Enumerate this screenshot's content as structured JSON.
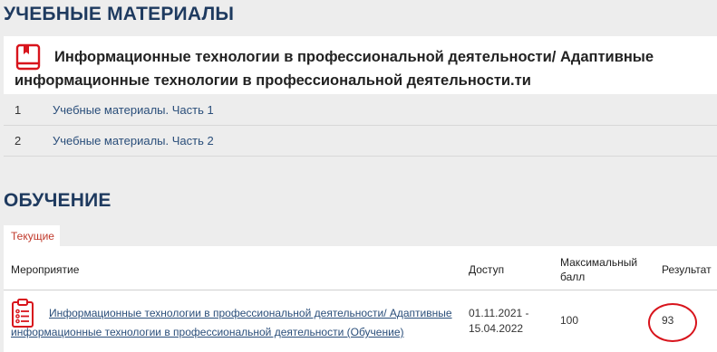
{
  "materials": {
    "title": "УЧЕБНЫЕ МАТЕРИАЛЫ",
    "course_title": "Информационные технологии в профессиональной деятельности/ Адаптивные информационные технологии в профессиональной деятельности.ти",
    "course_icon": "book-icon",
    "items": [
      {
        "num": "1",
        "label": "Учебные материалы. Часть 1"
      },
      {
        "num": "2",
        "label": "Учебные материалы. Часть 2"
      }
    ]
  },
  "training": {
    "title": "ОБУЧЕНИЕ",
    "tab_label": "Текущие",
    "headers": {
      "event": "Мероприятие",
      "access": "Доступ",
      "max_score": "Максимальный балл",
      "result": "Результат"
    },
    "rows": [
      {
        "icon": "clipboard-list-icon",
        "event": "Информационные технологии в профессиональной деятельности/ Адаптивные информационные технологии в профессиональной деятельности (Обучение)",
        "access": "01.11.2021 - 15.04.2022",
        "max_score": "100",
        "result": "93"
      }
    ]
  },
  "colors": {
    "heading": "#1e3a5f",
    "link": "#2a4e7a",
    "accent_red": "#d8141c",
    "background": "#ededed"
  }
}
